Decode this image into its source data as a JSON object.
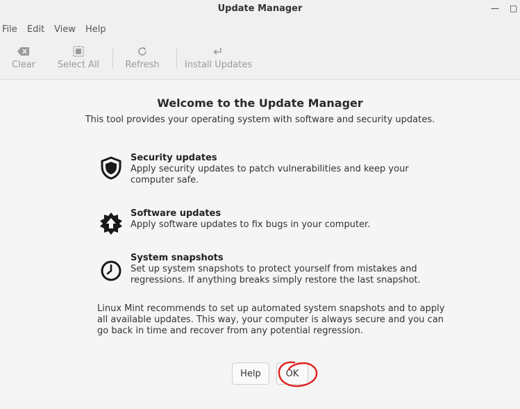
{
  "window": {
    "title": "Update Manager"
  },
  "menu": {
    "items": [
      "File",
      "Edit",
      "View",
      "Help"
    ]
  },
  "toolbar": {
    "items": [
      {
        "label": "Clear",
        "icon": "backspace-icon"
      },
      {
        "label": "Select All",
        "icon": "select-all-icon"
      },
      {
        "label": "Refresh",
        "icon": "refresh-icon"
      },
      {
        "label": "Install Updates",
        "icon": "install-icon"
      }
    ]
  },
  "welcome": {
    "title": "Welcome to the Update Manager",
    "subtitle": "This tool provides your operating system with software and security updates.",
    "features": [
      {
        "name": "Security updates",
        "description": "Apply security updates to patch vulnerabilities and keep your computer safe.",
        "icon": "shield-icon"
      },
      {
        "name": "Software updates",
        "description": "Apply software updates to fix bugs in your computer.",
        "icon": "upgrade-icon"
      },
      {
        "name": "System snapshots",
        "description": "Set up system snapshots to protect yourself from mistakes and regressions. If anything breaks simply restore the last snapshot.",
        "icon": "clock-icon"
      }
    ],
    "recommendation": "Linux Mint recommends to set up automated system snapshots and to apply all available updates. This way, your computer is always secure and you can go back in time and recover from any potential regression."
  },
  "buttons": {
    "help": "Help",
    "ok": "OK"
  },
  "colors": {
    "annotation": "#e02020",
    "disabled_text": "#9a9a9a"
  }
}
